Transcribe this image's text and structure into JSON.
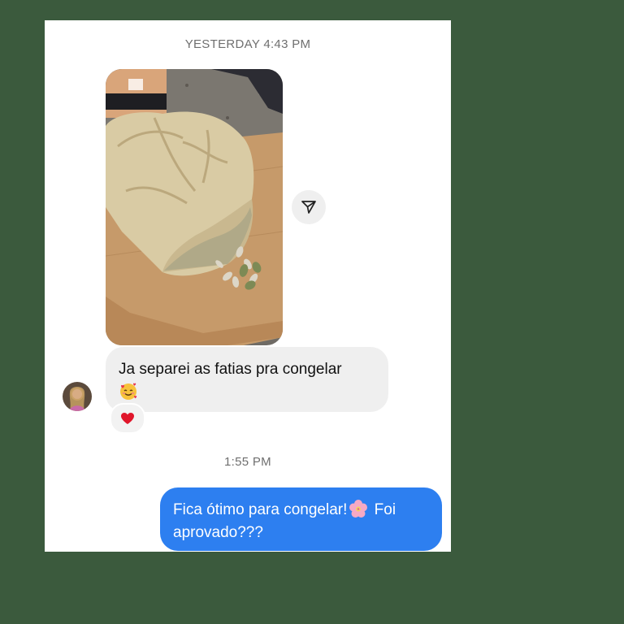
{
  "chat": {
    "timestamp_1": "YESTERDAY 4:43 PM",
    "timestamp_2": "1:55 PM",
    "incoming_message": {
      "text": "Ja separei as fatias pra congelar",
      "emoji": "smiling-face-with-hearts",
      "reaction": "red-heart"
    },
    "outgoing_message": {
      "text_before_emoji": "Fica ótimo para congelar!",
      "emoji": "cherry-blossom",
      "text_after_emoji": " Foi aprovado???"
    }
  },
  "icons": {
    "share": "paper-plane-icon",
    "avatar": "contact-avatar"
  },
  "colors": {
    "background": "#3b5a3d",
    "panel": "#ffffff",
    "incoming_bubble": "#efefef",
    "outgoing_bubble": "#2d7ff0",
    "timestamp_text": "#6f6f6f"
  }
}
